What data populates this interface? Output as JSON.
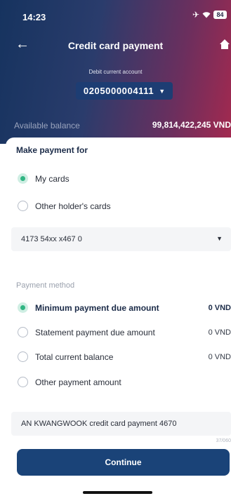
{
  "status_bar": {
    "time": "14:23",
    "airplane_icon": "airplane-icon",
    "wifi_icon": "wifi-icon",
    "battery": "84"
  },
  "header": {
    "back_icon": "arrow-left-icon",
    "title": "Credit card payment",
    "home_icon": "home-icon",
    "account_label": "Debit current account",
    "account_number": "0205000004111",
    "account_caret": "chevron-down-icon",
    "balance_label": "Available balance",
    "balance_value": "99,814,422,245 VND"
  },
  "payment_for": {
    "title": "Make payment for",
    "options": [
      {
        "label": "My cards",
        "selected": true
      },
      {
        "label": "Other holder's cards",
        "selected": false
      }
    ]
  },
  "card_select": {
    "value": "4173 54xx x467 0"
  },
  "payment_method": {
    "label": "Payment method",
    "options": [
      {
        "label": "Minimum payment due amount",
        "amount": "0 VND",
        "selected": true
      },
      {
        "label": "Statement payment due amount",
        "amount": "0 VND",
        "selected": false
      },
      {
        "label": "Total current balance",
        "amount": "0 VND",
        "selected": false
      },
      {
        "label": "Other payment amount",
        "amount": "",
        "selected": false
      }
    ]
  },
  "memo": {
    "value": "AN KWANGWOOK credit card payment 4670",
    "char_count": "37/060"
  },
  "continue_button": "Continue",
  "colors": {
    "accent": "#31b583",
    "primary": "#1a4378",
    "title": "#1b2b48"
  }
}
